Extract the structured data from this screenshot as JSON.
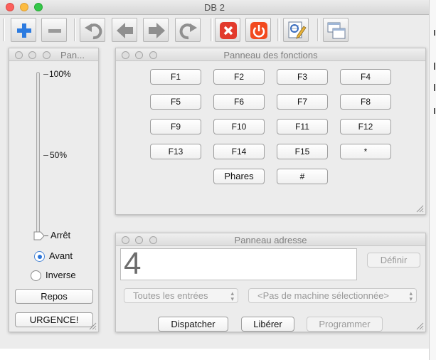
{
  "window": {
    "title": "DB 2"
  },
  "toolbar": {
    "buttons": [
      {
        "icon": "plus-icon"
      },
      {
        "icon": "minus-icon"
      },
      {
        "icon": "undo-icon"
      },
      {
        "icon": "arrow-left-icon"
      },
      {
        "icon": "arrow-right-icon"
      },
      {
        "icon": "redo-icon"
      },
      {
        "icon": "stop-icon"
      },
      {
        "icon": "power-icon"
      },
      {
        "icon": "edit-icon"
      },
      {
        "icon": "windows-icon"
      }
    ]
  },
  "speed_panel": {
    "title": "Pan...",
    "scale_max": "100%",
    "scale_mid": "50%",
    "scale_min": "Arrêt",
    "speed_level_percent": 0,
    "direction_options": [
      "Avant",
      "Inverse"
    ],
    "selected_direction": "Avant",
    "repos_label": "Repos",
    "urgence_label": "URGENCE!"
  },
  "functions_panel": {
    "title": "Panneau des fonctions",
    "rows": [
      [
        "F1",
        "F2",
        "F3",
        "F4"
      ],
      [
        "F5",
        "F6",
        "F7",
        "F8"
      ],
      [
        "F9",
        "F10",
        "F11",
        "F12"
      ],
      [
        "F13",
        "F14",
        "F15",
        "*"
      ],
      [
        "Phares",
        "#"
      ]
    ]
  },
  "address_panel": {
    "title": "Panneau adresse",
    "address_value": "4",
    "define_label": "Définir",
    "entries_select": "Toutes les entrées",
    "machine_select": "<Pas de machine sélectionnée>",
    "dispatch_label": "Dispatcher",
    "release_label": "Libérer",
    "program_label": "Programmer"
  },
  "colors": {
    "stop": "#e23a2c",
    "power": "#f24a1e",
    "plus": "#2c7be0",
    "selected_radio": "#2a74d8"
  }
}
